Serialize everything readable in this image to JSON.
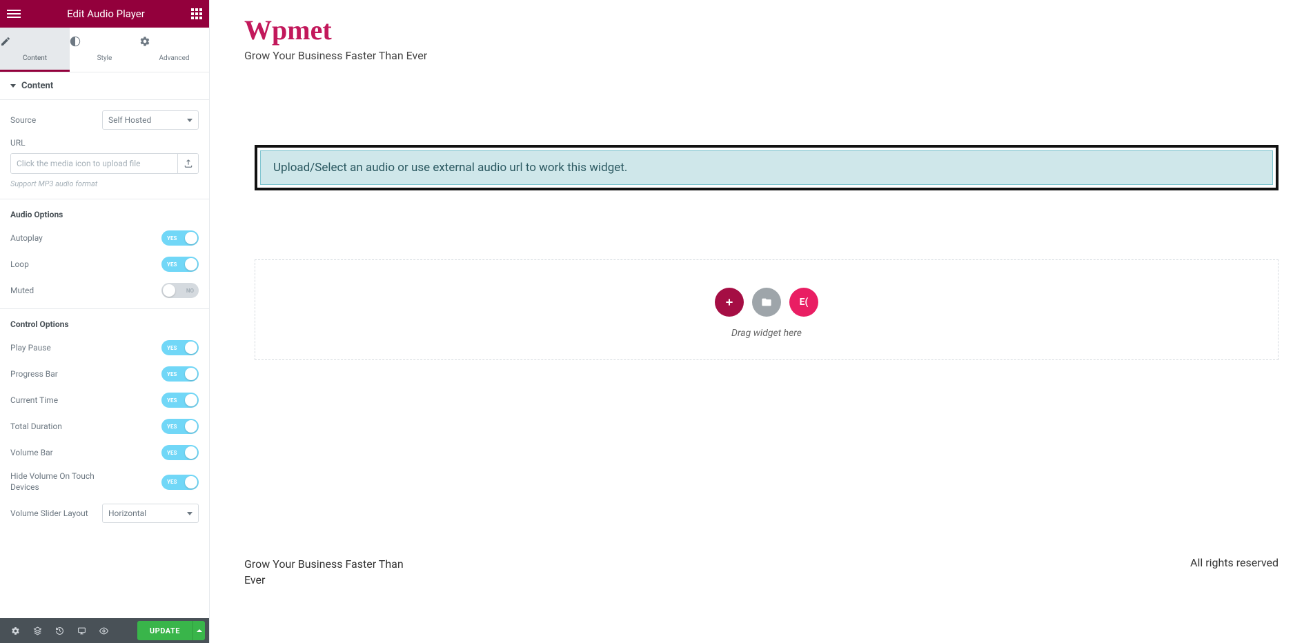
{
  "header": {
    "title": "Edit Audio Player"
  },
  "tabs": {
    "content": "Content",
    "style": "Style",
    "advanced": "Advanced"
  },
  "section": {
    "content": "Content"
  },
  "source": {
    "label": "Source",
    "value": "Self Hosted"
  },
  "url": {
    "label": "URL",
    "placeholder": "Click the media icon to upload file",
    "hint": "Support MP3 audio format"
  },
  "audioOptions": {
    "heading": "Audio Options",
    "autoplay": {
      "label": "Autoplay",
      "value": "YES"
    },
    "loop": {
      "label": "Loop",
      "value": "YES"
    },
    "muted": {
      "label": "Muted",
      "value": "NO"
    }
  },
  "controlOptions": {
    "heading": "Control Options",
    "playPause": {
      "label": "Play Pause",
      "value": "YES"
    },
    "progressBar": {
      "label": "Progress Bar",
      "value": "YES"
    },
    "currentTime": {
      "label": "Current Time",
      "value": "YES"
    },
    "totalDuration": {
      "label": "Total Duration",
      "value": "YES"
    },
    "volumeBar": {
      "label": "Volume Bar",
      "value": "YES"
    },
    "hideVolumeTouch": {
      "label": "Hide Volume On Touch Devices",
      "value": "YES"
    },
    "volumeSliderLayout": {
      "label": "Volume Slider Layout",
      "value": "Horizontal"
    }
  },
  "footer": {
    "update": "UPDATE"
  },
  "canvas": {
    "siteTitle": "Wpmet",
    "siteTagline": "Grow Your Business Faster Than Ever",
    "widgetMessage": "Upload/Select an audio or use external audio url to work this widget.",
    "dropHint": "Drag widget here",
    "copyright": "All rights reserved",
    "footerTagline": "Grow Your Business Faster Than Ever",
    "ekLabel": "E("
  }
}
